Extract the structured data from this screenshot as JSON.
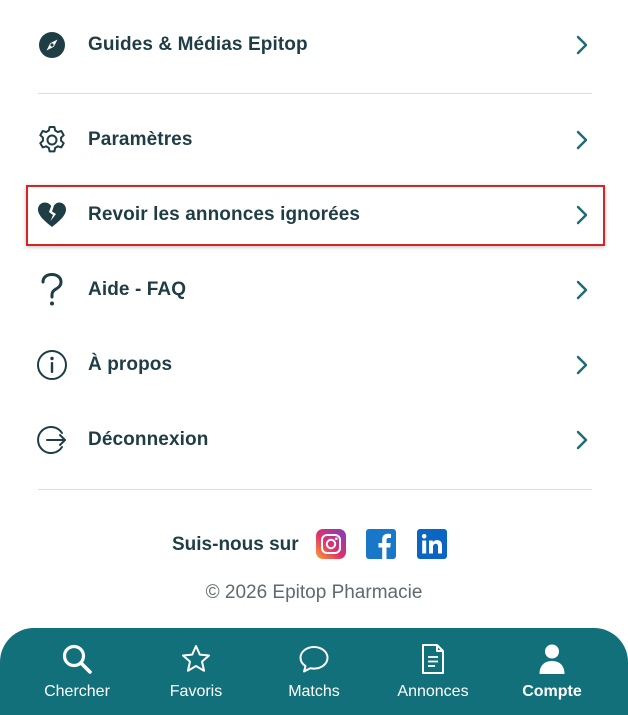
{
  "menu": {
    "items": [
      {
        "label": "Guides & Médias Epitop",
        "icon": "compass-icon"
      },
      {
        "label": "Paramètres",
        "icon": "gear-icon"
      },
      {
        "label": "Revoir les annonces ignorées",
        "icon": "broken-heart-icon"
      },
      {
        "label": "Aide - FAQ",
        "icon": "question-mark-icon"
      },
      {
        "label": "À propos",
        "icon": "info-icon"
      },
      {
        "label": "Déconnexion",
        "icon": "logout-icon"
      }
    ]
  },
  "social": {
    "follow_label": "Suis-nous sur",
    "networks": [
      "instagram-icon",
      "facebook-icon",
      "linkedin-icon"
    ]
  },
  "footer": {
    "copyright": "© 2026 Epitop Pharmacie"
  },
  "bottom_nav": {
    "items": [
      {
        "label": "Chercher",
        "icon": "search-icon"
      },
      {
        "label": "Favoris",
        "icon": "star-icon"
      },
      {
        "label": "Matchs",
        "icon": "chat-bubble-icon"
      },
      {
        "label": "Annonces",
        "icon": "document-icon"
      },
      {
        "label": "Compte",
        "icon": "user-icon"
      }
    ],
    "active": "Compte"
  },
  "colors": {
    "text": "#1f3d45",
    "accent": "#12707a",
    "highlight": "#d62424",
    "chevron": "#1e6b78"
  }
}
